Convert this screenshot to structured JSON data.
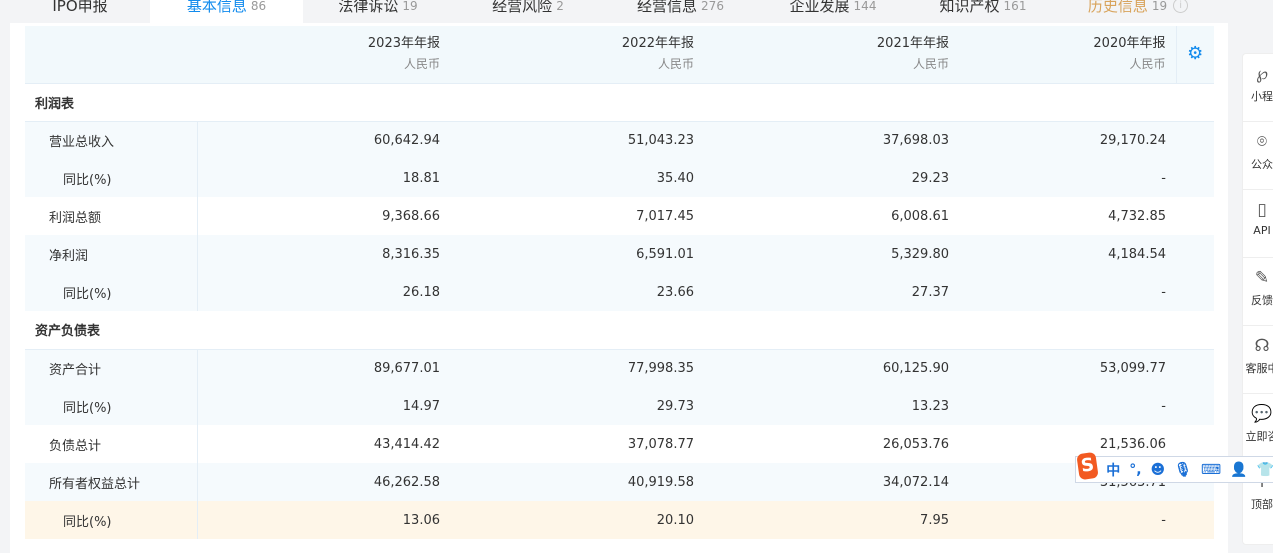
{
  "tabs": [
    {
      "label": "IPO申报",
      "count": ""
    },
    {
      "label": "基本信息",
      "count": "86"
    },
    {
      "label": "法律诉讼",
      "count": "19"
    },
    {
      "label": "经营风险",
      "count": "2"
    },
    {
      "label": "经营信息",
      "count": "276"
    },
    {
      "label": "企业发展",
      "count": "144"
    },
    {
      "label": "知识产权",
      "count": "161"
    },
    {
      "label": "历史信息",
      "count": "19"
    }
  ],
  "table": {
    "columns": [
      {
        "year": "2023年年报",
        "currency": "人民币"
      },
      {
        "year": "2022年年报",
        "currency": "人民币"
      },
      {
        "year": "2021年年报",
        "currency": "人民币"
      },
      {
        "year": "2020年年报",
        "currency": "人民币"
      }
    ],
    "sections": [
      {
        "title": "利润表",
        "rows": [
          {
            "label": "营业总收入",
            "values": [
              "60,642.94",
              "51,043.23",
              "37,698.03",
              "29,170.24"
            ]
          },
          {
            "label": "同比(%)",
            "values": [
              "18.81",
              "35.40",
              "29.23",
              "-"
            ]
          },
          {
            "label": "利润总额",
            "values": [
              "9,368.66",
              "7,017.45",
              "6,008.61",
              "4,732.85"
            ]
          },
          {
            "label": "净利润",
            "values": [
              "8,316.35",
              "6,591.01",
              "5,329.80",
              "4,184.54"
            ]
          },
          {
            "label": "同比(%)",
            "values": [
              "26.18",
              "23.66",
              "27.37",
              "-"
            ]
          }
        ]
      },
      {
        "title": "资产负债表",
        "rows": [
          {
            "label": "资产合计",
            "values": [
              "89,677.01",
              "77,998.35",
              "60,125.90",
              "53,099.77"
            ]
          },
          {
            "label": "同比(%)",
            "values": [
              "14.97",
              "29.73",
              "13.23",
              "-"
            ]
          },
          {
            "label": "负债总计",
            "values": [
              "43,414.42",
              "37,078.77",
              "26,053.76",
              "21,536.06"
            ]
          },
          {
            "label": "所有者权益总计",
            "values": [
              "46,262.58",
              "40,919.58",
              "34,072.14",
              "31,563.71"
            ]
          },
          {
            "label": "同比(%)",
            "values": [
              "13.06",
              "20.10",
              "7.95",
              "-"
            ]
          }
        ]
      }
    ]
  },
  "sidebar": [
    {
      "label": "小程"
    },
    {
      "label": "公众"
    },
    {
      "label": "API"
    },
    {
      "label": "反馈"
    },
    {
      "label": "客服中"
    },
    {
      "label": "立即咨"
    },
    {
      "label": "顶部"
    }
  ],
  "ime": {
    "logo": "S",
    "mode": "中"
  }
}
